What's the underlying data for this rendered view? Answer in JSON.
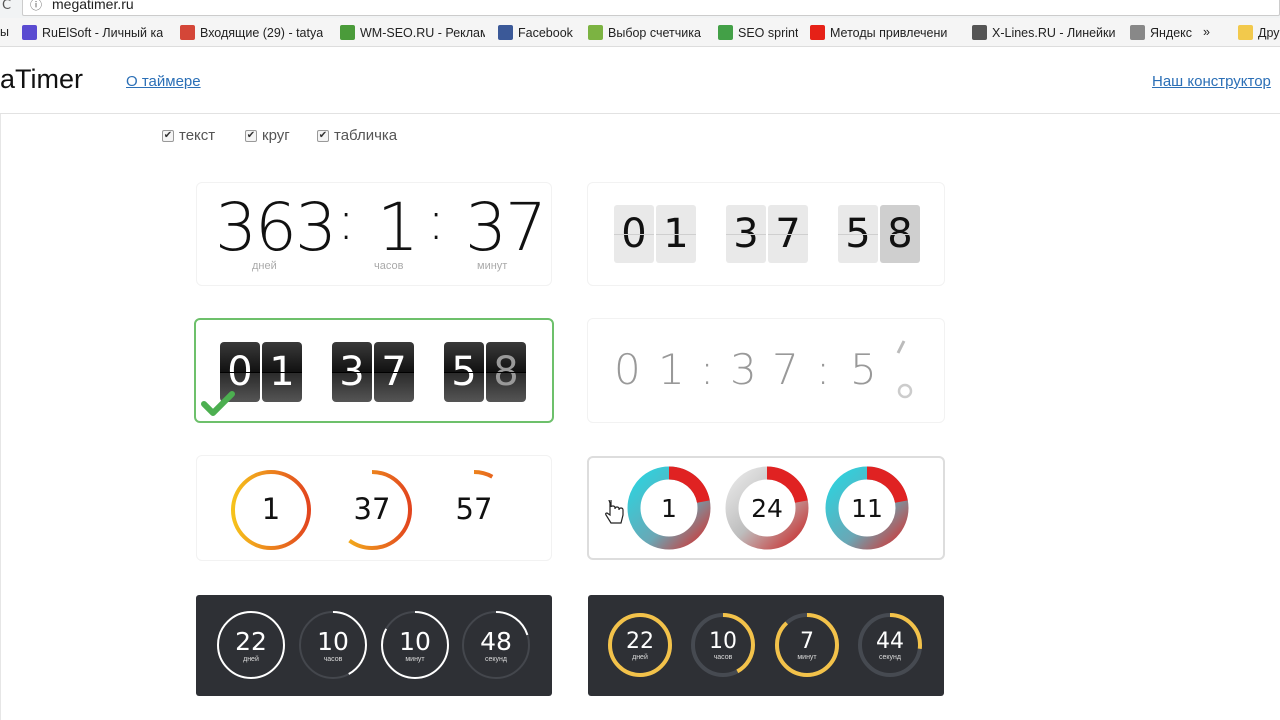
{
  "browser": {
    "url": "megatimer.ru",
    "bookmarks": [
      {
        "label": "ы",
        "icon": "",
        "color": ""
      },
      {
        "label": "RuElSoft - Личный ка",
        "icon": "ruelsoft-icon",
        "color": "#5a4bd1"
      },
      {
        "label": "Входящие (29) - tatya",
        "icon": "gmail-icon",
        "color": "#d44638"
      },
      {
        "label": "WM-SEO.RU - Реклам",
        "icon": "wm-icon",
        "color": "#4a9b3a"
      },
      {
        "label": "Facebook",
        "icon": "facebook-icon",
        "color": "#3b5998"
      },
      {
        "label": "Выбор счетчика",
        "icon": "counter-icon",
        "color": "#7cb342"
      },
      {
        "label": "SEO sprint",
        "icon": "seosprint-icon",
        "color": "#43a047"
      },
      {
        "label": "Методы привлечени",
        "icon": "youtube-icon",
        "color": "#e62117"
      },
      {
        "label": "X-Lines.RU - Линейки",
        "icon": "xlines-icon",
        "color": "#555555"
      },
      {
        "label": "Яндекс",
        "icon": "page-icon",
        "color": "#888888"
      },
      {
        "label": "»",
        "icon": "",
        "color": ""
      },
      {
        "label": "Дру",
        "icon": "folder-icon",
        "color": "#f2c94c"
      }
    ]
  },
  "header": {
    "logo": "aTimer",
    "about_link": "О таймере",
    "constructor_link": "Наш конструктор"
  },
  "filters": [
    {
      "label": "текст",
      "checked": true
    },
    {
      "label": "круг",
      "checked": true
    },
    {
      "label": "табличка",
      "checked": true
    }
  ],
  "timers": {
    "text_big": {
      "days": "363",
      "hours": "1",
      "minutes": "37",
      "sep": ":",
      "unit_days": "дней",
      "unit_hours": "часов",
      "unit_minutes": "минут"
    },
    "flip_light": {
      "digits": [
        "0",
        "1",
        "3",
        "7",
        "5",
        "8"
      ]
    },
    "flip_dark": {
      "digits": [
        "0",
        "1",
        "3",
        "7",
        "5",
        "8"
      ]
    },
    "thin_text": {
      "text": [
        "0",
        "1",
        ":",
        "3",
        "7",
        ":",
        "5"
      ]
    },
    "rings_orange": [
      {
        "value": "1",
        "fraction": 1.0
      },
      {
        "value": "37",
        "fraction": 0.6
      },
      {
        "value": "57",
        "fraction": 0.08
      }
    ],
    "rings_gradient": [
      {
        "value": "1"
      },
      {
        "value": "24"
      },
      {
        "value": "11"
      }
    ],
    "dark_white": [
      {
        "value": "22",
        "unit": "дней",
        "fraction": 1.0
      },
      {
        "value": "10",
        "unit": "часов",
        "fraction": 0.42
      },
      {
        "value": "10",
        "unit": "минут",
        "fraction": 0.83
      },
      {
        "value": "48",
        "unit": "секунд",
        "fraction": 0.2
      }
    ],
    "dark_yellow": [
      {
        "value": "22",
        "unit": "дней",
        "fraction": 1.0
      },
      {
        "value": "10",
        "unit": "часов",
        "fraction": 0.42
      },
      {
        "value": "7",
        "unit": "минут",
        "fraction": 0.88
      },
      {
        "value": "44",
        "unit": "секунд",
        "fraction": 0.27
      }
    ]
  },
  "colors": {
    "link": "#2b6fb6",
    "green_check": "#4caf50",
    "ring_orange": "#f4a21a",
    "ring_red": "#e02222",
    "ring_cyan": "#27c6d6",
    "ring_yellow": "#f3c24a",
    "dark_bg": "#2e3035"
  }
}
